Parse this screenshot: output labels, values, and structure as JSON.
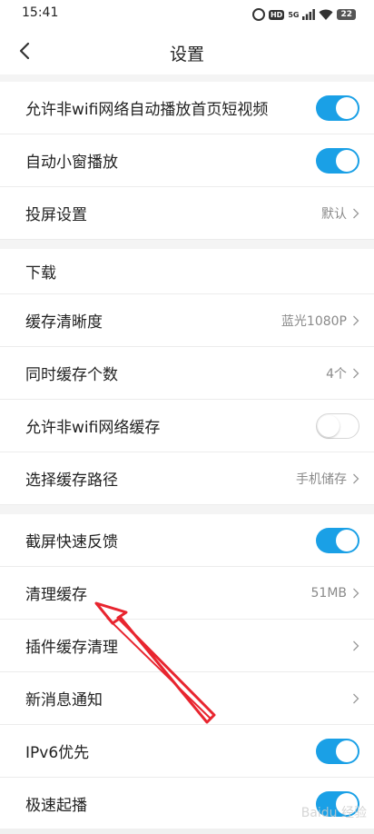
{
  "status_bar": {
    "time": "15:41",
    "battery": "22",
    "network": "5G",
    "hd": "HD"
  },
  "header": {
    "title": "设置"
  },
  "playback": [
    {
      "label": "允许非wifi网络自动播放首页短视频",
      "toggle": "on"
    },
    {
      "label": "自动小窗播放",
      "toggle": "on"
    },
    {
      "label": "投屏设置",
      "value": "默认"
    }
  ],
  "download": {
    "section_title": "下载",
    "rows": [
      {
        "label": "缓存清晰度",
        "value": "蓝光1080P"
      },
      {
        "label": "同时缓存个数",
        "value": "4个"
      },
      {
        "label": "允许非wifi网络缓存",
        "toggle": "off"
      },
      {
        "label": "选择缓存路径",
        "value": "手机储存"
      }
    ]
  },
  "misc": [
    {
      "label": "截屏快速反馈",
      "toggle": "on"
    },
    {
      "label": "清理缓存",
      "value": "51MB"
    },
    {
      "label": "插件缓存清理"
    },
    {
      "label": "新消息通知"
    },
    {
      "label": "IPv6优先",
      "toggle": "on"
    },
    {
      "label": "极速起播",
      "toggle": "on"
    }
  ],
  "colors": {
    "accent": "#1aa0e6",
    "annotation": "#e8252f"
  },
  "watermark": "Baidu 经验"
}
